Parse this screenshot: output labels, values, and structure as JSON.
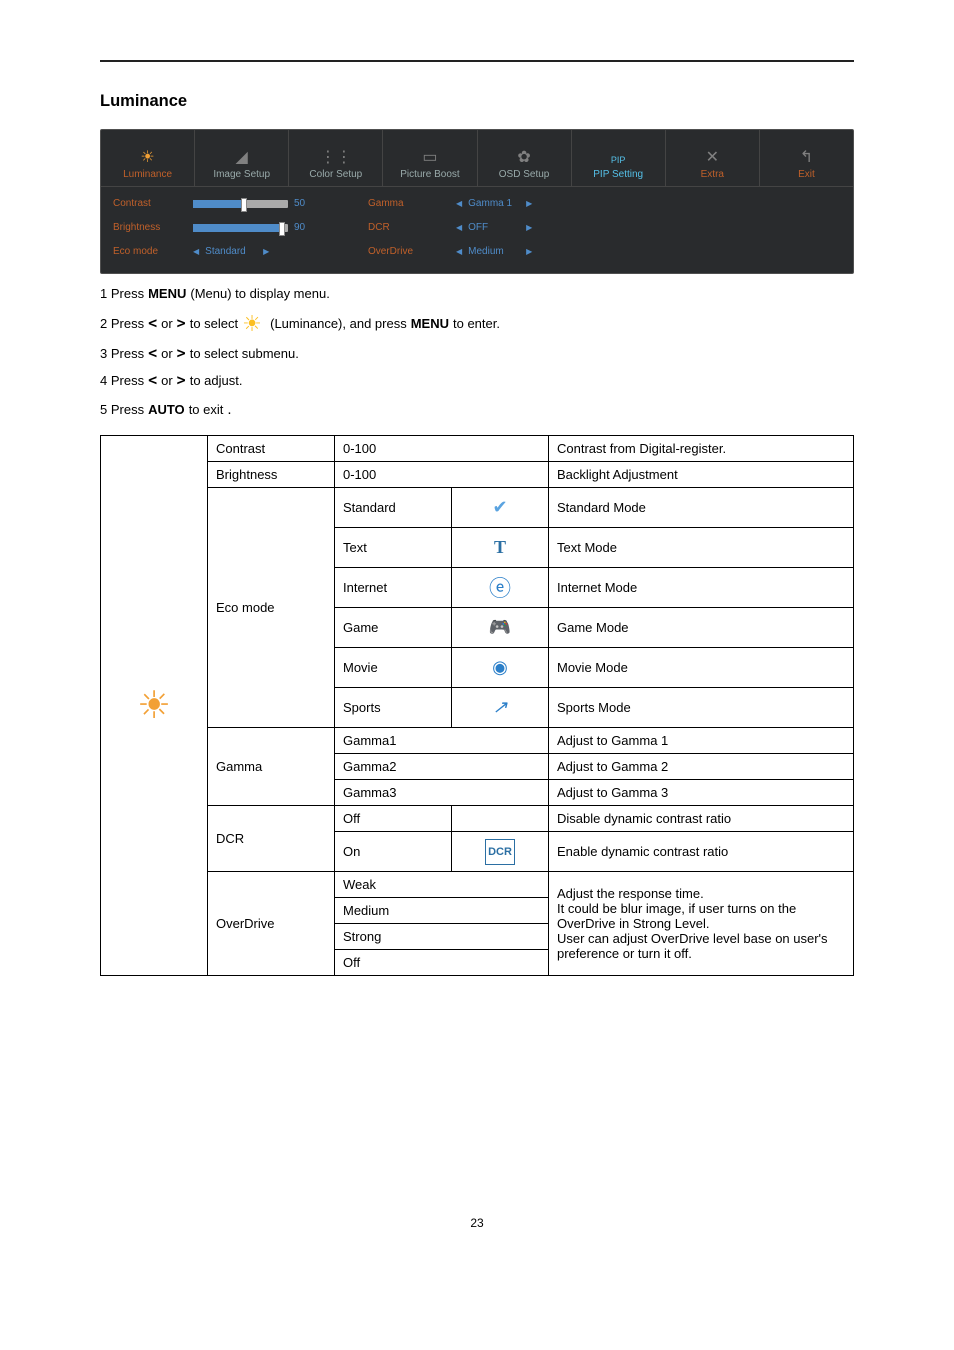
{
  "page_number": "23",
  "section_title": "Luminance",
  "osd": {
    "tabs": [
      {
        "label": "Luminance"
      },
      {
        "label": "Image Setup"
      },
      {
        "label": "Color Setup"
      },
      {
        "label": "Picture Boost"
      },
      {
        "label": "OSD Setup"
      },
      {
        "label": "PIP",
        "label2": "PIP Setting"
      },
      {
        "label": "Extra"
      },
      {
        "label": "Exit"
      }
    ],
    "col1": {
      "contrast": "Contrast",
      "brightness": "Brightness",
      "eco": "Eco mode"
    },
    "sliders": {
      "contrast_val": "50",
      "brightness_val": "90",
      "eco_val": "Standard"
    },
    "col2": {
      "gamma": "Gamma",
      "dcr": "DCR",
      "overdrive": "OverDrive"
    },
    "vals2": {
      "gamma": "Gamma 1",
      "dcr": "OFF",
      "overdrive": "Medium"
    }
  },
  "instr": {
    "l1a": "1 Press ",
    "l1b": "MENU",
    "l1c": " (Menu) to display menu.",
    "l2a": "2 Press ",
    "l2b": " or ",
    "l2c": " to select ",
    "l2d": " (Luminance), and press ",
    "l2e": "MENU",
    "l2f": " to enter.",
    "l3a": "3 Press ",
    "l3b": " or ",
    "l3c": " to select submenu.",
    "l4a": "4 Press ",
    "l4b": " or ",
    "l4c": " to adjust.",
    "l5a": "5 Press  ",
    "l5b": "AUTO",
    "l5c": "  to exit",
    "period": "."
  },
  "tbl": {
    "contrast": {
      "name": "Contrast",
      "range": "0-100",
      "desc": "Contrast from Digital-register."
    },
    "brightness": {
      "name": "Brightness",
      "range": "0-100",
      "desc": "Backlight Adjustment"
    },
    "eco": {
      "name": "Eco mode",
      "rows": [
        {
          "name": "Standard",
          "desc": "Standard Mode"
        },
        {
          "name": "Text",
          "desc": "Text Mode"
        },
        {
          "name": "Internet",
          "desc": "Internet Mode"
        },
        {
          "name": "Game",
          "desc": "Game Mode"
        },
        {
          "name": "Movie",
          "desc": "Movie Mode"
        },
        {
          "name": "Sports",
          "desc": "Sports Mode"
        }
      ]
    },
    "gamma": {
      "name": "Gamma",
      "rows": [
        {
          "name": "Gamma1",
          "desc": "Adjust to Gamma 1"
        },
        {
          "name": "Gamma2",
          "desc": "Adjust to Gamma 2"
        },
        {
          "name": "Gamma3",
          "desc": "Adjust to Gamma 3"
        }
      ]
    },
    "dcr": {
      "name": "DCR",
      "rows": [
        {
          "name": "Off",
          "desc": "Disable dynamic contrast ratio"
        },
        {
          "name": "On",
          "desc": "Enable dynamic contrast ratio"
        }
      ]
    },
    "overdrive": {
      "name": "OverDrive",
      "rows": [
        {
          "name": "Weak"
        },
        {
          "name": "Medium"
        },
        {
          "name": "Strong"
        },
        {
          "name": "Off"
        }
      ],
      "desc": "Adjust the response time.\nIt could be blur image, if user turns on the OverDrive in Strong Level.\nUser can adjust OverDrive level base on user's preference or turn it off."
    }
  }
}
